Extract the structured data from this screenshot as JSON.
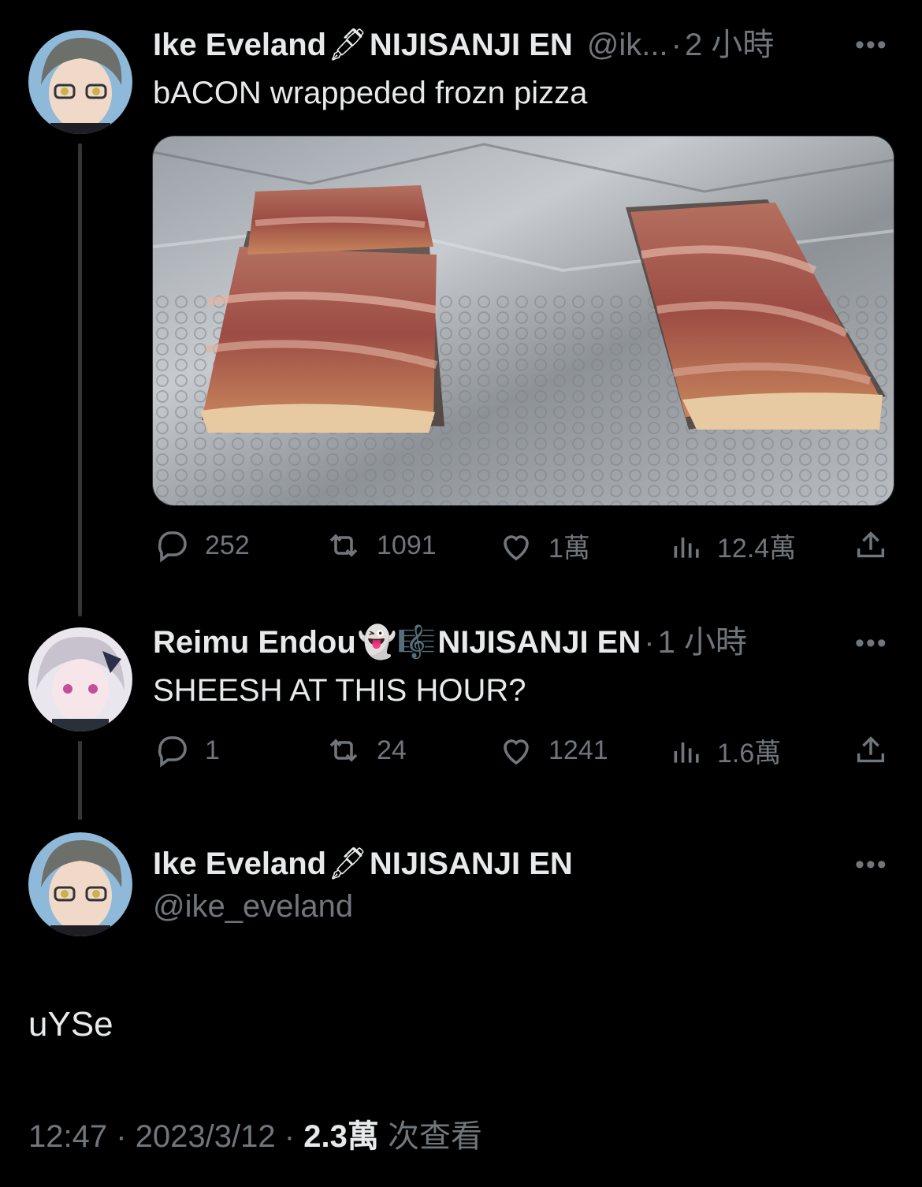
{
  "tweets": [
    {
      "author": "Ike Eveland",
      "emoji": "🖋",
      "org": "NIJISANJI EN",
      "handle": "@ik...",
      "time": "2 小時",
      "text": "bACON wrappeded frozn pizza",
      "stats": {
        "replies": "252",
        "reposts": "1091",
        "likes": "1萬",
        "views": "12.4萬"
      }
    },
    {
      "author": "Reimu Endou",
      "emoji": "👻🎼",
      "org": "NIJISANJI EN",
      "time": "1 小時",
      "text": "SHEESH AT THIS HOUR?",
      "stats": {
        "replies": "1",
        "reposts": "24",
        "likes": "1241",
        "views": "1.6萬"
      }
    }
  ],
  "main": {
    "author": "Ike Eveland",
    "emoji": "🖋",
    "org": "NIJISANJI EN",
    "handle": "@ike_eveland",
    "text": "uYSe",
    "time": "12:47",
    "date": "2023/3/12",
    "views": "2.3萬",
    "views_label": "次查看"
  },
  "ui": {
    "dot": "·",
    "more": "•••"
  },
  "colors": {
    "background": "#000000",
    "text": "#e7e9ea",
    "muted": "#71767b",
    "line": "#333639"
  }
}
